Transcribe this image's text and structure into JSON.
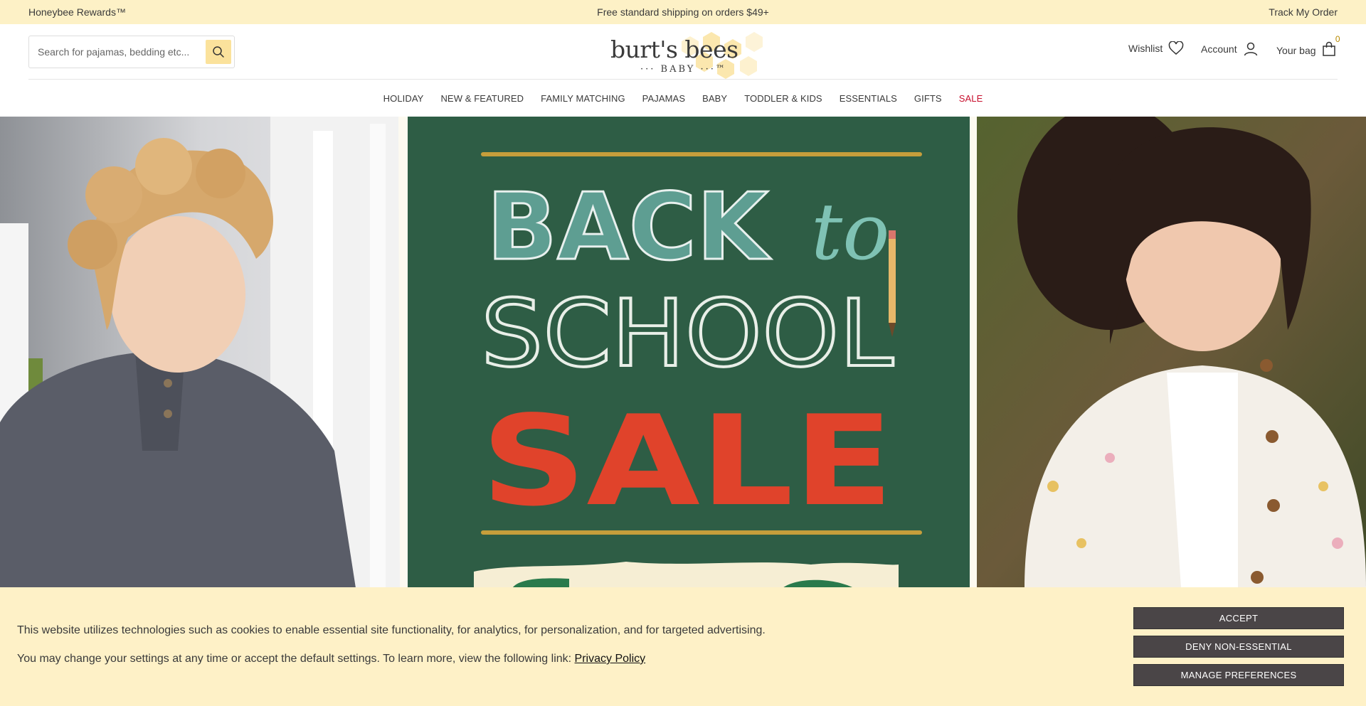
{
  "promo_bar": {
    "rewards": "Honeybee Rewards™",
    "shipping": "Free standard shipping on orders $49+",
    "track": "Track My Order"
  },
  "header": {
    "search_placeholder": "Search for pajamas, bedding etc...",
    "logo_brand": "burt's bees",
    "logo_sub": "··· BABY ···™",
    "wishlist": "Wishlist",
    "account": "Account",
    "bag": "Your bag",
    "bag_count": "0"
  },
  "nav": {
    "items": [
      "HOLIDAY",
      "NEW & FEATURED",
      "FAMILY MATCHING",
      "PAJAMAS",
      "BABY",
      "TODDLER & KIDS",
      "ESSENTIALS",
      "GIFTS",
      "SALE"
    ]
  },
  "hero": {
    "line1": "BACK",
    "line1_script": "to",
    "line2": "SCHOOL",
    "line3": "SALE",
    "chalkboard_color": "#2e5d45",
    "accent_teal": "#5e9e92",
    "accent_red": "#e0432b"
  },
  "cookie": {
    "text1": "This website utilizes technologies such as cookies to enable essential site functionality, for analytics, for personalization, and for targeted advertising.",
    "text2": "You may change your settings at any time or accept the default settings. To learn more, view the following link:",
    "privacy_link": "Privacy Policy",
    "accept": "ACCEPT",
    "deny": "DENY NON-ESSENTIAL",
    "manage": "MANAGE PREFERENCES"
  },
  "colors": {
    "promo_bg": "#fdf1c6",
    "cookie_bg": "#fef1c7",
    "button_bg": "#4a4547",
    "sale_red": "#c8102e"
  }
}
